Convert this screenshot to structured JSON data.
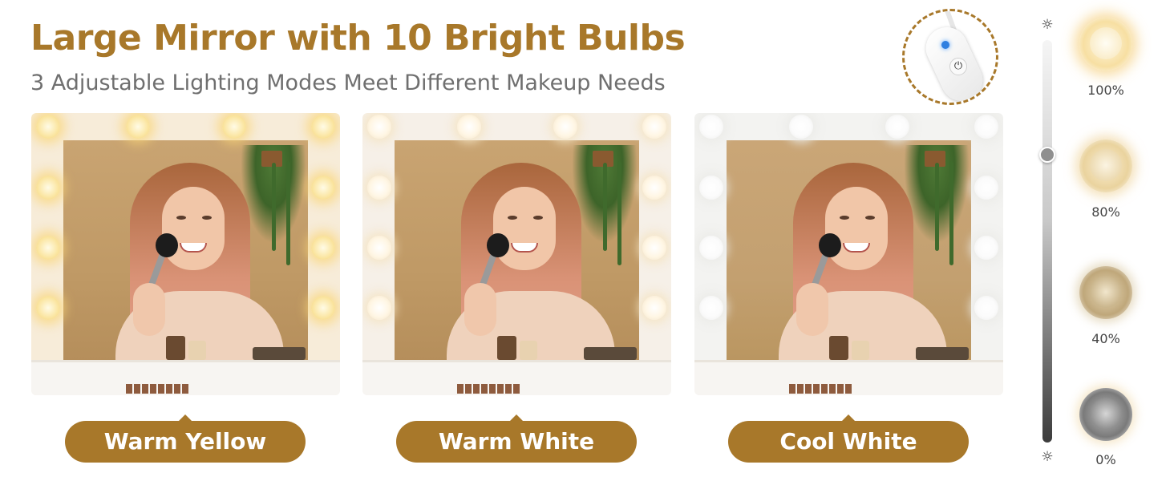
{
  "header": {
    "title": "Large Mirror with 10 Bright Bulbs",
    "subtitle": "3 Adjustable Lighting Modes Meet Different Makeup Needs"
  },
  "remote": {
    "icon": "power-icon",
    "power_glyph": "⏻"
  },
  "modes": [
    {
      "label": "Warm Yellow",
      "color": "#f4d27a"
    },
    {
      "label": "Warm White",
      "color": "#f3e3c6"
    },
    {
      "label": "Cool White",
      "color": "#ececea"
    }
  ],
  "brightness_slider": {
    "icon_top": "sun-icon",
    "icon_bottom": "sun-icon",
    "sun_glyph": "☼",
    "value_percent": 80
  },
  "brightness_levels": [
    {
      "label": "100%"
    },
    {
      "label": "80%"
    },
    {
      "label": "40%"
    },
    {
      "label": "0%"
    }
  ],
  "colors": {
    "brand": "#a8782a",
    "subtitle": "#6f6f6f"
  }
}
